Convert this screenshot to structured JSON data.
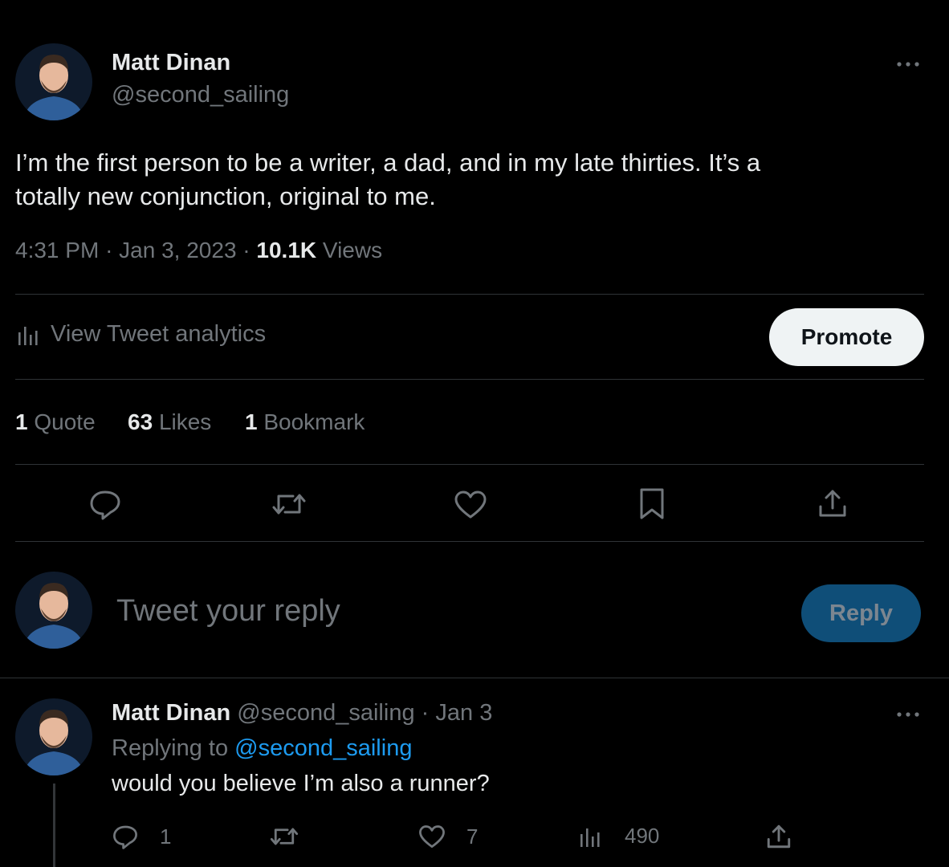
{
  "tweet": {
    "author_name": "Matt Dinan",
    "author_handle": "@second_sailing",
    "text_line1": "I’m the first person to be a writer, a dad, and in my late thirties. It’s a",
    "text_line2": "totally new conjunction, original to me.",
    "time": "4:31 PM",
    "sep1": "·",
    "date": "Jan 3, 2023",
    "sep2": "·",
    "views_count": "10.1K",
    "views_label": "Views"
  },
  "analytics": {
    "label": "View Tweet analytics",
    "promote_label": "Promote"
  },
  "stats": [
    {
      "count": "1",
      "label": "Quote"
    },
    {
      "count": "63",
      "label": "Likes"
    },
    {
      "count": "1",
      "label": "Bookmark"
    }
  ],
  "actions": [
    "reply-icon",
    "retweet-icon",
    "like-icon",
    "bookmark-icon",
    "share-icon"
  ],
  "composer": {
    "placeholder": "Tweet your reply",
    "reply_label": "Reply"
  },
  "reply": {
    "author_name": "Matt Dinan",
    "author_handle": "@second_sailing",
    "sep": "·",
    "date": "Jan 3",
    "replying_prefix": "Replying to",
    "replying_handle": "@second_sailing",
    "text": "would you believe I’m also a runner?",
    "reply_count": "1",
    "like_count": "7",
    "views_count": "490"
  },
  "colors": {
    "accent": "#1d9bf0",
    "reply_button_bg": "#0f4e78",
    "divider": "#2f3336",
    "muted": "#71767b"
  }
}
